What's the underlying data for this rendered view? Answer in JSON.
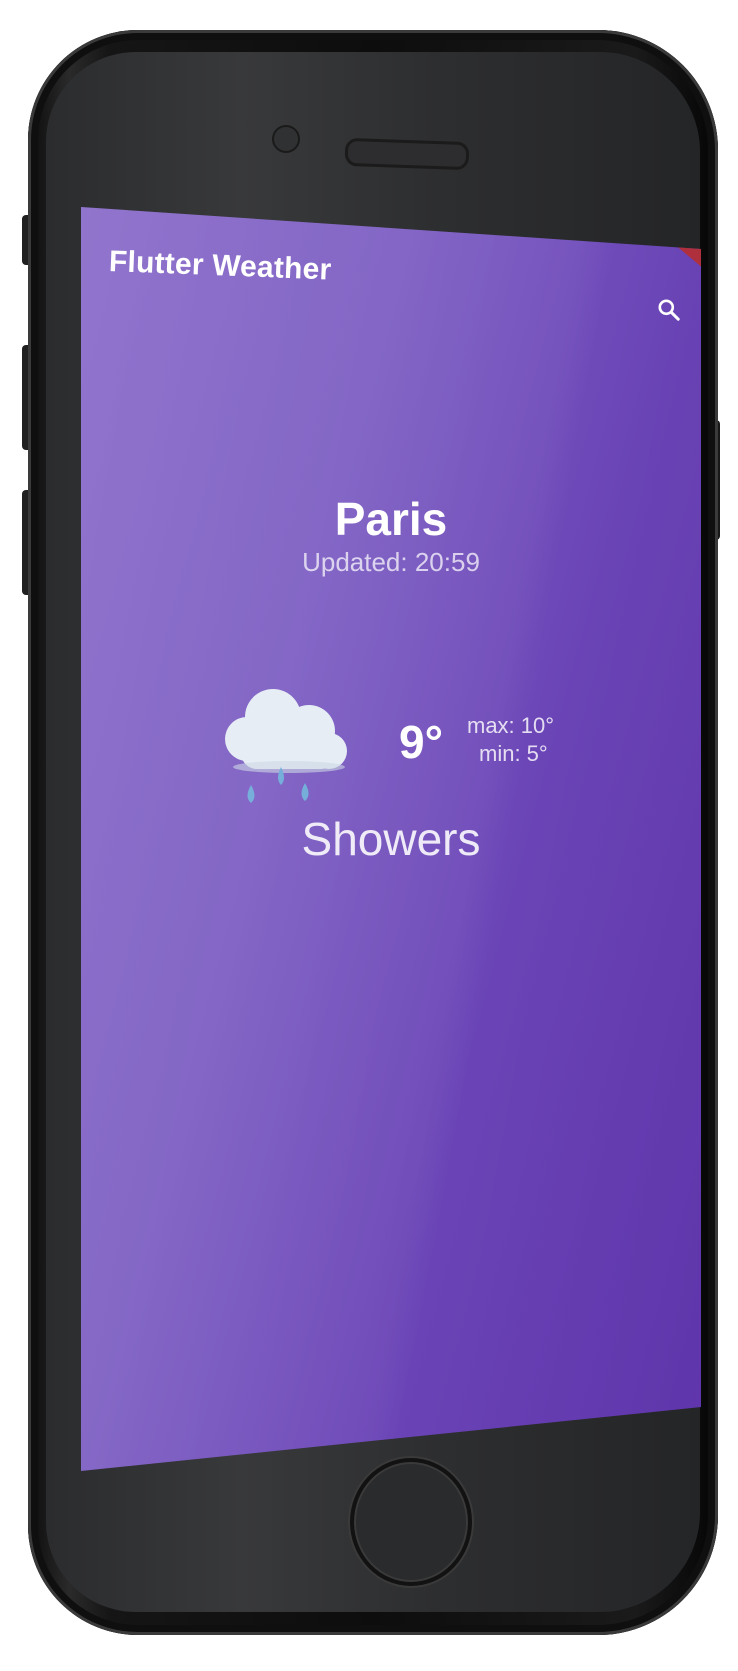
{
  "app_bar": {
    "title": "Flutter Weather",
    "search_icon": "search-icon"
  },
  "weather": {
    "city": "Paris",
    "updated": "Updated: 20:59",
    "temperature": "9°",
    "max": "max: 10°",
    "min": "min: 5°",
    "condition": "Showers",
    "condition_icon": "rain-cloud-icon"
  },
  "colors": {
    "screen_background": "#7b5cc2",
    "cloud": "#e4ecf4",
    "raindrop": "#6da9d8",
    "text": "#ffffff"
  }
}
